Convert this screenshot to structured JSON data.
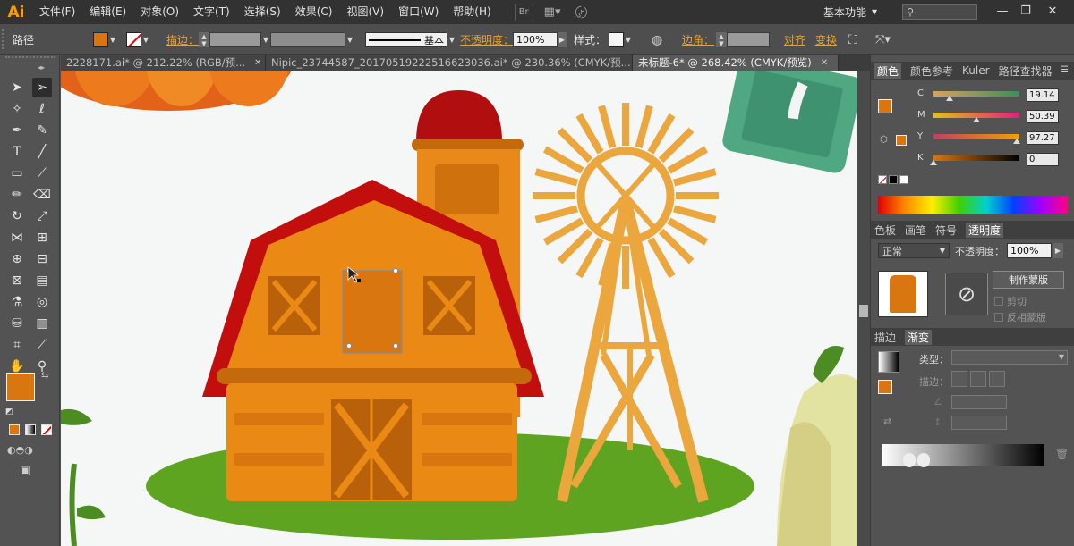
{
  "app": {
    "logo": "Ai"
  },
  "menu": [
    "文件(F)",
    "编辑(E)",
    "对象(O)",
    "文字(T)",
    "选择(S)",
    "效果(C)",
    "视图(V)",
    "窗口(W)",
    "帮助(H)"
  ],
  "menubar_icons": {
    "bridge": "Br",
    "arrange": "▦▾",
    "gpu": "〄"
  },
  "workspace": {
    "label": "基本功能",
    "arrow": "▾"
  },
  "search": {
    "icon": "⚲",
    "placeholder": ""
  },
  "window_controls": {
    "minimize": "—",
    "restore": "❐",
    "close": "✕"
  },
  "control_bar": {
    "object_type": "路径",
    "stroke_label": "描边：",
    "stroke_profile": "基本",
    "opacity_label": "不透明度：",
    "opacity_value": "100%",
    "style_label": "样式：",
    "corner_label": "边角：",
    "align_label": "对齐",
    "transform_label": "变换",
    "fill_color": "#d9760f"
  },
  "doc_tabs": [
    {
      "label": "2228171.ai* @ 212.22% (RGB/预...",
      "active": false
    },
    {
      "label": "Nipic_23744587_20170519222516623036.ai* @ 230.36% (CMYK/预...",
      "active": false
    },
    {
      "label": "未标题-6* @ 268.42% (CMYK/预览)",
      "active": true
    }
  ],
  "tab_close": "✕",
  "panels": {
    "color_tabs": [
      "颜色",
      "颜色参考",
      "Kuler",
      "路径查找器"
    ],
    "cmyk": [
      {
        "channel": "C",
        "value": "19.14",
        "fraction": 0.19
      },
      {
        "channel": "M",
        "value": "50.39",
        "fraction": 0.5
      },
      {
        "channel": "Y",
        "value": "97.27",
        "fraction": 0.97
      },
      {
        "channel": "K",
        "value": "0",
        "fraction": 0.0
      }
    ],
    "transparency_tabs": [
      "色板",
      "画笔",
      "符号",
      "透明度"
    ],
    "blend_mode": "正常",
    "opacity_label": "不透明度：",
    "opacity_value": "100%",
    "make_mask": "制作蒙版",
    "clip_label": "剪切",
    "invert_mask_label": "反相蒙版",
    "gradient_tabs": [
      "描边",
      "渐变"
    ],
    "gradient_type_label": "类型：",
    "gradient_stroke_label": "描边："
  },
  "colors": {
    "accent_orange": "#d9760f",
    "barn_body": "#ea8a15",
    "barn_dark": "#b8600a",
    "roof_red": "#c30e0e",
    "windmill": "#eba63d",
    "grass": "#5fa421"
  }
}
